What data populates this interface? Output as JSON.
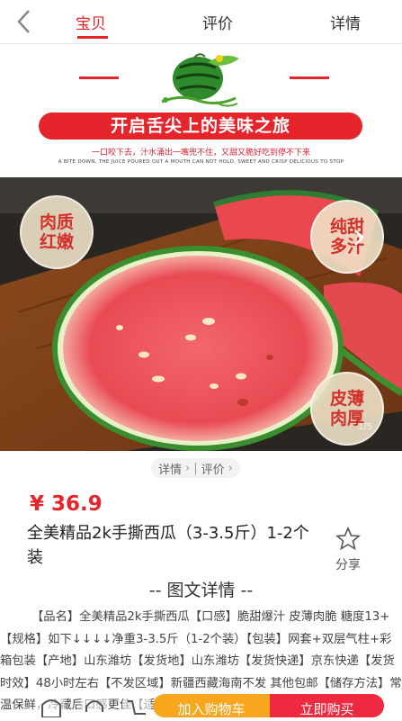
{
  "header": {
    "tabs": [
      {
        "label": "宝贝",
        "active": true
      },
      {
        "label": "评价",
        "active": false
      },
      {
        "label": "详情",
        "active": false
      }
    ]
  },
  "banner": {
    "title": "开启舌尖上的美味之旅",
    "subtitle": "一口咬下去，汁水涌出一嘴兜不住，又甜又脆好吃到停不下来",
    "subtitle_en": "A BITE DOWN, THE JUICE POURED OUT A MOUTH CAN NOT HOLD, SWEET AND CRISP DELICIOUS TO STOP"
  },
  "badges": [
    {
      "line1": "肉质",
      "line2": "红嫩"
    },
    {
      "line1": "纯甜",
      "line2": "多汁"
    },
    {
      "line1": "皮薄",
      "line2": "肉厚"
    }
  ],
  "image_counter": "1/5",
  "breadcrumb": {
    "details": "详情",
    "reviews": "评价"
  },
  "product": {
    "price": "¥ 36.9",
    "title": "全美精品2k手撕西瓜（3-3.5斤）1-2个装",
    "share_label": "分享"
  },
  "section": {
    "title": "-- 图文详情 --"
  },
  "description": "【品名】全美精品2k手撕西瓜【口感】脆甜爆汁 皮薄肉脆 糖度13+【规格】如下↓↓↓↓净重3-3.5斤（1-2个装）【包装】网套+双层气柱+彩箱包装【产地】山东潍坊【发货地】山东潍坊【发货快递】京东快递【发货时效】48小时左右【不发区域】新疆西藏海南不发 其他包邮【储存方法】常温保鲜，冷藏后口感更佳【适用人群】老少皆宜",
  "bottom_bar": {
    "add_cart": "加入购物车",
    "buy_now": "立即购买"
  },
  "colors": {
    "accent": "#e5242b",
    "cart": "#f7a61e",
    "buy": "#ef2a40"
  }
}
